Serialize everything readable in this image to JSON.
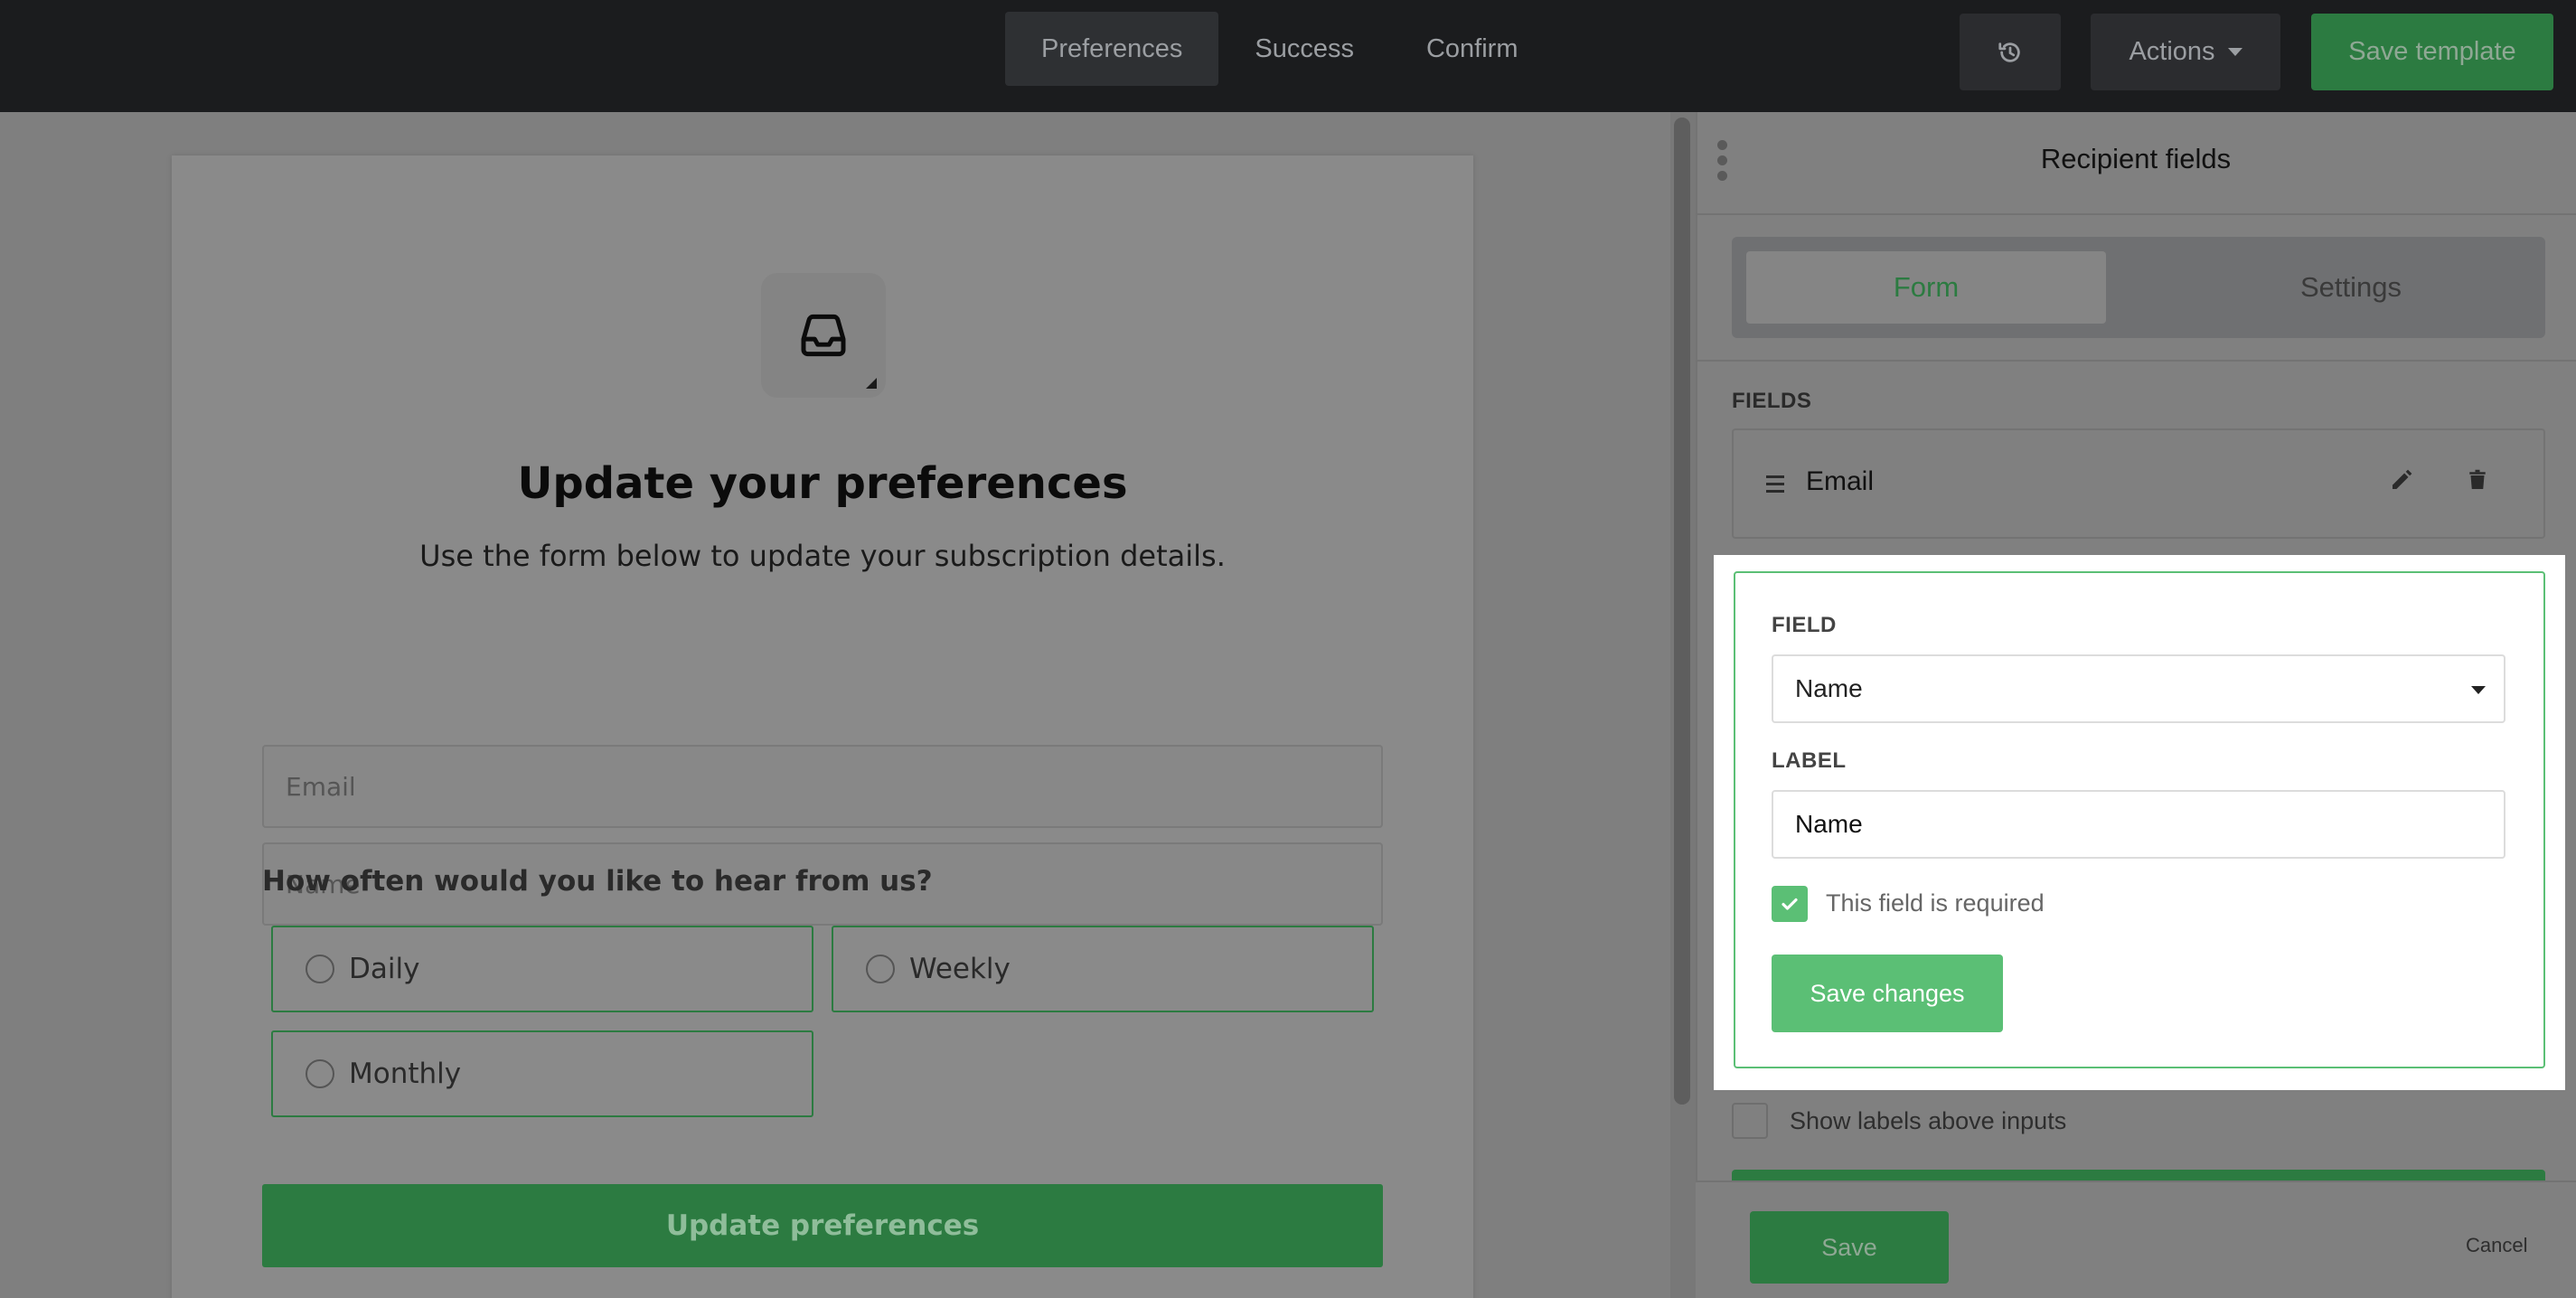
{
  "topbar": {
    "tabs": [
      {
        "label": "Preferences",
        "active": true
      },
      {
        "label": "Success",
        "active": false
      },
      {
        "label": "Confirm",
        "active": false
      }
    ],
    "history_icon": "history-icon",
    "actions_label": "Actions",
    "save_template_label": "Save template"
  },
  "preview": {
    "logo_icon": "inbox-icon",
    "title": "Update your preferences",
    "subtitle": "Use the form below to update your subscription details.",
    "email_placeholder": "Email",
    "name_placeholder": "Name",
    "question": "How often would you like to hear from us?",
    "options": [
      "Daily",
      "Weekly",
      "Monthly"
    ],
    "submit_label": "Update preferences"
  },
  "panel": {
    "title": "Recipient fields",
    "tabs": [
      {
        "label": "Form",
        "active": true
      },
      {
        "label": "Settings",
        "active": false
      }
    ],
    "fields_heading": "FIELDS",
    "fields": [
      {
        "name": "Email"
      }
    ],
    "editor": {
      "field_heading": "FIELD",
      "field_value": "Name",
      "label_heading": "LABEL",
      "label_value": "Name",
      "required_label": "This field is required",
      "required_checked": true,
      "save_label": "Save changes"
    },
    "show_labels_text": "Show labels above inputs",
    "show_labels_checked": false,
    "save_label": "Save",
    "cancel_label": "Cancel"
  },
  "colors": {
    "brand_green": "#5bbf75",
    "dark_green": "#2c7b41",
    "topbar_bg": "#1b1c1e",
    "overlay": "#7f7f7f"
  }
}
